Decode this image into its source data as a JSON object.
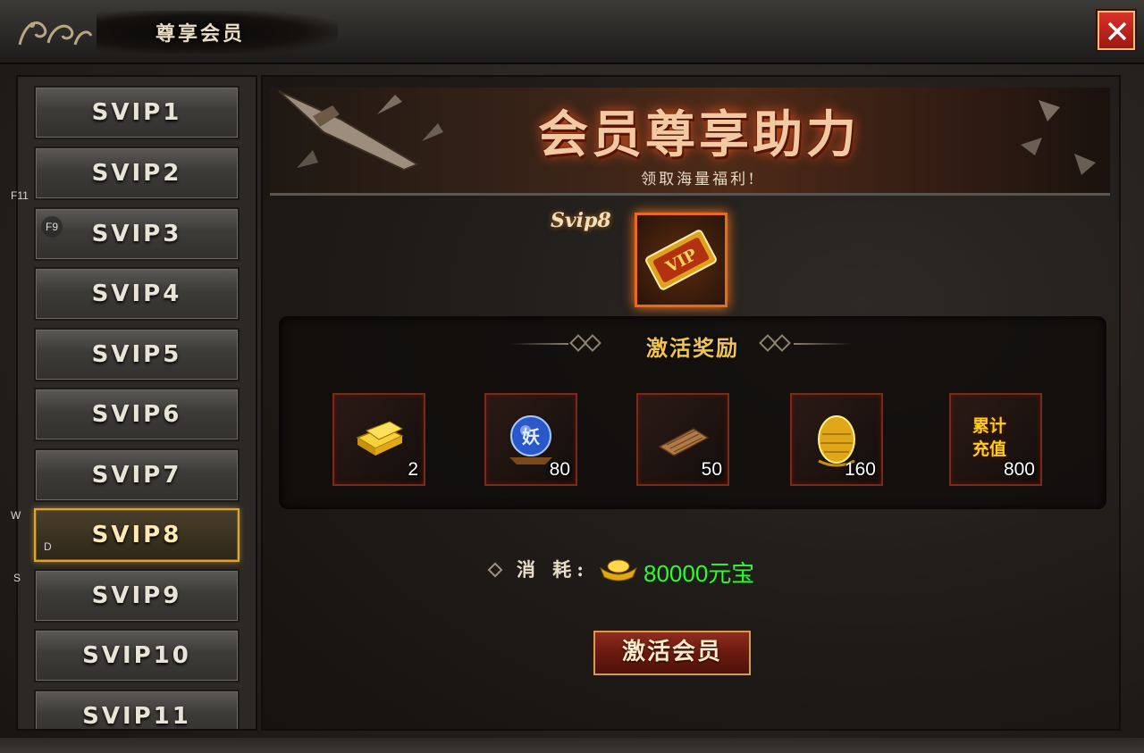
{
  "window": {
    "title": "尊享会员",
    "emblem": "ℤ",
    "close_icon": "close-icon"
  },
  "sidebar": {
    "items": [
      {
        "label": "SVIP1"
      },
      {
        "label": "SVIP2"
      },
      {
        "label": "SVIP3"
      },
      {
        "label": "SVIP4"
      },
      {
        "label": "SVIP5"
      },
      {
        "label": "SVIP6"
      },
      {
        "label": "SVIP7"
      },
      {
        "label": "SVIP8",
        "active": true
      },
      {
        "label": "SVIP9"
      },
      {
        "label": "SVIP10"
      },
      {
        "label": "SVIP11"
      }
    ]
  },
  "hotkeys": {
    "f11": "F11",
    "f9": "F9",
    "w": "W",
    "d": "D",
    "s": "S"
  },
  "banner": {
    "title": "会员尊享助力",
    "subtitle": "领取海量福利!"
  },
  "current_level": {
    "name": "Svip8",
    "icon": "vip-ticket-icon"
  },
  "rewards": {
    "title": "激活奖励",
    "items": [
      {
        "icon": "gold-bars-icon",
        "count": "2"
      },
      {
        "icon": "demon-orb-icon",
        "count": "80"
      },
      {
        "icon": "scroll-icon",
        "count": "50"
      },
      {
        "icon": "golden-egg-icon",
        "count": "160"
      },
      {
        "icon": "recharge-text-icon",
        "label": "累计充值",
        "count": "800"
      }
    ]
  },
  "cost": {
    "label": "消 耗:",
    "currency_icon": "ingot-icon",
    "value": "80000元宝"
  },
  "activate_button": {
    "label": "激活会员"
  },
  "colors": {
    "cost_value": "#2aff2a",
    "reward_title": "#f0c44e",
    "active_border": "#d8a73a"
  }
}
